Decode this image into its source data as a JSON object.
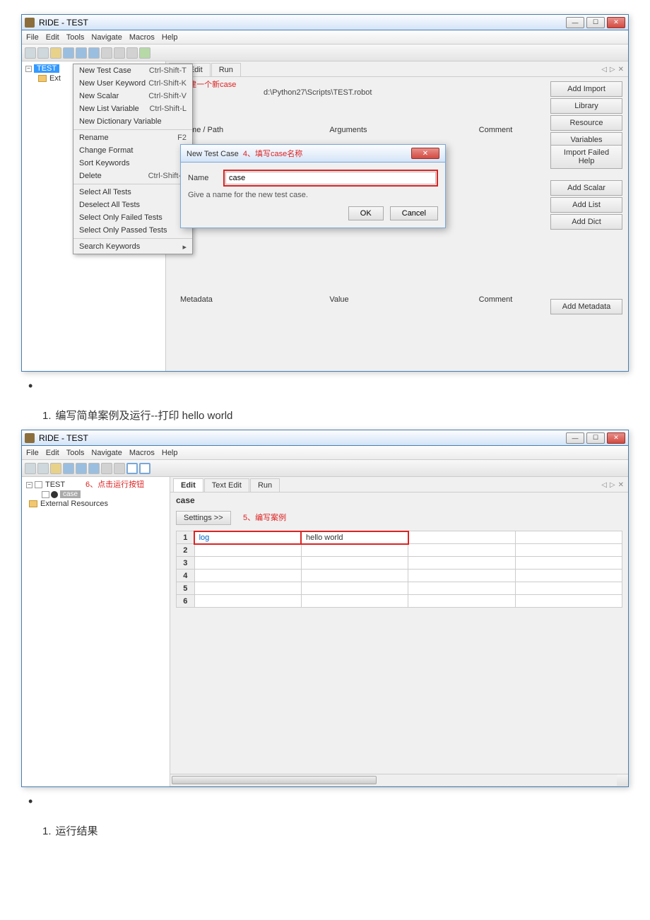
{
  "window1": {
    "title": "RIDE - TEST",
    "menubar": [
      "File",
      "Edit",
      "Tools",
      "Navigate",
      "Macros",
      "Help"
    ],
    "tree": {
      "root": "TEST",
      "child": "Ext"
    },
    "context_menu": {
      "group1": [
        {
          "label": "New Test Case",
          "shortcut": "Ctrl-Shift-T"
        },
        {
          "label": "New User Keyword",
          "shortcut": "Ctrl-Shift-K"
        },
        {
          "label": "New Scalar",
          "shortcut": "Ctrl-Shift-V"
        },
        {
          "label": "New List Variable",
          "shortcut": "Ctrl-Shift-L"
        },
        {
          "label": "New Dictionary Variable",
          "shortcut": ""
        }
      ],
      "group2": [
        {
          "label": "Rename",
          "shortcut": "F2"
        },
        {
          "label": "Change Format",
          "shortcut": ""
        },
        {
          "label": "Sort Keywords",
          "shortcut": ""
        },
        {
          "label": "Delete",
          "shortcut": "Ctrl-Shift-D"
        }
      ],
      "group3": [
        {
          "label": "Select All Tests",
          "shortcut": ""
        },
        {
          "label": "Deselect All Tests",
          "shortcut": ""
        },
        {
          "label": "Select Only Failed Tests",
          "shortcut": ""
        },
        {
          "label": "Select Only Passed Tests",
          "shortcut": ""
        }
      ],
      "group4": [
        {
          "label": "Search Keywords",
          "shortcut": "▸"
        }
      ]
    },
    "tabs": [
      "ext Edit",
      "Run"
    ],
    "annot3": "3、创建一个新case",
    "source_path": "d:\\Python27\\Scripts\\TEST.robot",
    "expand_label": ">>",
    "section_cols": [
      "Name / Path",
      "Arguments",
      "Comment"
    ],
    "right_buttons_top": [
      "Add Import",
      "Library",
      "Resource",
      "Variables"
    ],
    "right_buttons_mid": [
      "Import Failed Help",
      "Add Scalar",
      "Add List",
      "Add Dict"
    ],
    "right_button_meta": "Add Metadata",
    "dialog": {
      "title_prefix": "New Test Case",
      "title_annot": "4、填写case名称",
      "name_label": "Name",
      "name_value": "case",
      "hint": "Give a name for the new test case.",
      "ok": "OK",
      "cancel": "Cancel"
    },
    "meta_cols": [
      "Metadata",
      "Value",
      "Comment"
    ]
  },
  "doc": {
    "heading1_num": "1.",
    "heading1_text": "编写简单案例及运行--打印 hello world",
    "heading2_num": "1.",
    "heading2_text": "运行结果"
  },
  "window2": {
    "title": "RIDE - TEST",
    "menubar": [
      "File",
      "Edit",
      "Tools",
      "Navigate",
      "Macros",
      "Help"
    ],
    "tree": {
      "root": "TEST",
      "annot6": "6、点击运行按钮",
      "case_label": "case",
      "ext_res": "External Resources"
    },
    "tabs": [
      "Edit",
      "Text Edit",
      "Run"
    ],
    "case_title": "case",
    "settings_btn": "Settings >>",
    "annot5": "5、编写案例",
    "grid": {
      "rows": [
        "1",
        "2",
        "3",
        "4",
        "5",
        "6"
      ],
      "cell_1_1": "log",
      "cell_1_2": "hello world"
    }
  }
}
